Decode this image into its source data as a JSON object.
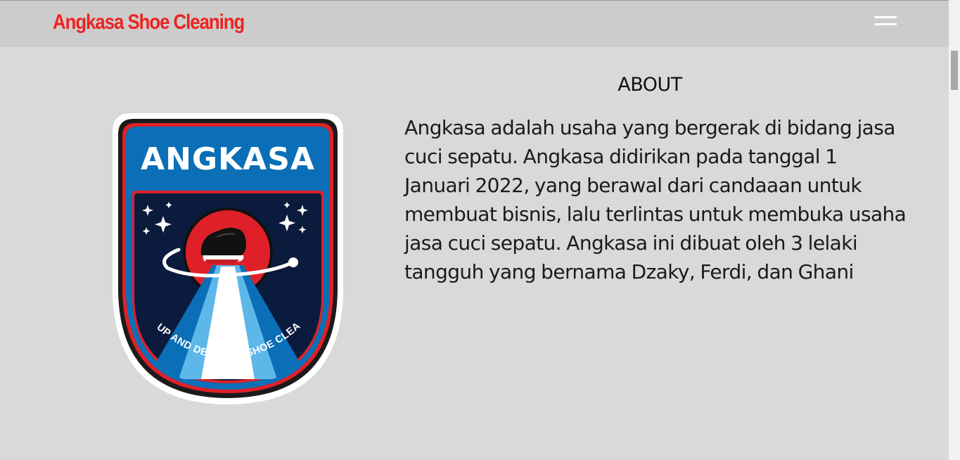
{
  "navbar": {
    "brand": "Angkasa Shoe Cleaning",
    "menu_icon": "hamburger-menu-icon"
  },
  "logo": {
    "word": "ANGKASA",
    "tagline": "PICK UP AND DELIVERY SHOE CLEANING"
  },
  "about": {
    "title": "ABOUT",
    "body": "Angkasa adalah usaha yang bergerak di bidang jasa cuci sepatu. Angkasa didirikan pada tanggal 1 Januari 2022, yang berawal dari candaaan untuk membuat bisnis, lalu terlintas untuk membuka usaha jasa cuci sepatu. Angkasa ini dibuat oleh 3 lelaki tangguh yang bernama Dzaky, Ferdi, dan Ghani"
  },
  "colors": {
    "brand": "#ee2222",
    "background": "#d9d9d9",
    "navbar": "#cccccc"
  }
}
